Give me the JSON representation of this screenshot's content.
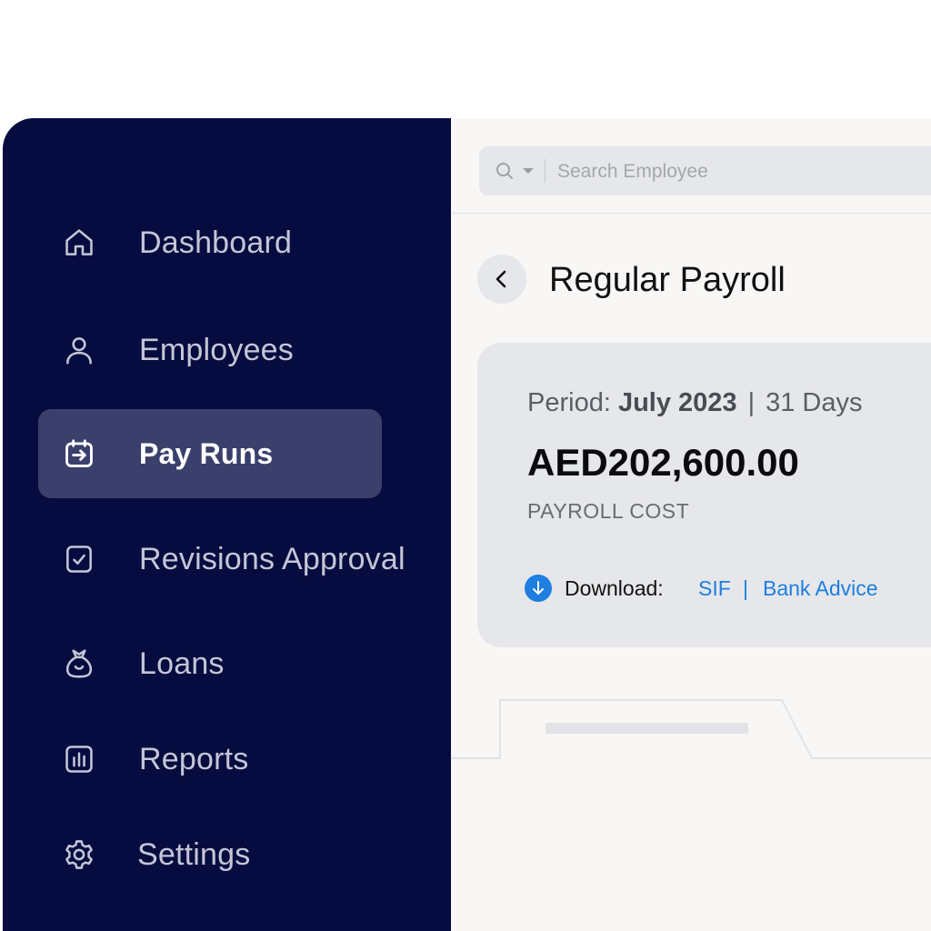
{
  "sidebar": {
    "items": [
      {
        "label": "Dashboard",
        "icon": "home-icon",
        "active": false
      },
      {
        "label": "Employees",
        "icon": "person-icon",
        "active": false
      },
      {
        "label": "Pay Runs",
        "icon": "calendar-arrow-icon",
        "active": true
      },
      {
        "label": "Revisions Approval",
        "icon": "checkbox-icon",
        "active": false
      },
      {
        "label": "Loans",
        "icon": "money-bag-icon",
        "active": false
      },
      {
        "label": "Reports",
        "icon": "bar-chart-icon",
        "active": false
      },
      {
        "label": "Settings",
        "icon": "gear-icon",
        "active": false
      }
    ]
  },
  "search": {
    "placeholder": "Search Employee",
    "icon": "search-icon"
  },
  "page": {
    "title": "Regular Payroll",
    "back_icon": "chevron-left-icon"
  },
  "summary": {
    "period_label": "Period:",
    "period_value": "July 2023",
    "separator": "|",
    "days": "31 Days",
    "amount": "AED202,600.00",
    "amount_label": "PAYROLL COST",
    "download_label": "Download:",
    "download_links": [
      "SIF",
      "Bank Advice"
    ],
    "link_separator": "|"
  },
  "colors": {
    "sidebar_bg": "#060c3f",
    "active_item_bg": "#3a3f6b",
    "link": "#1e7fe0",
    "card_bg": "#e6e7ea"
  }
}
